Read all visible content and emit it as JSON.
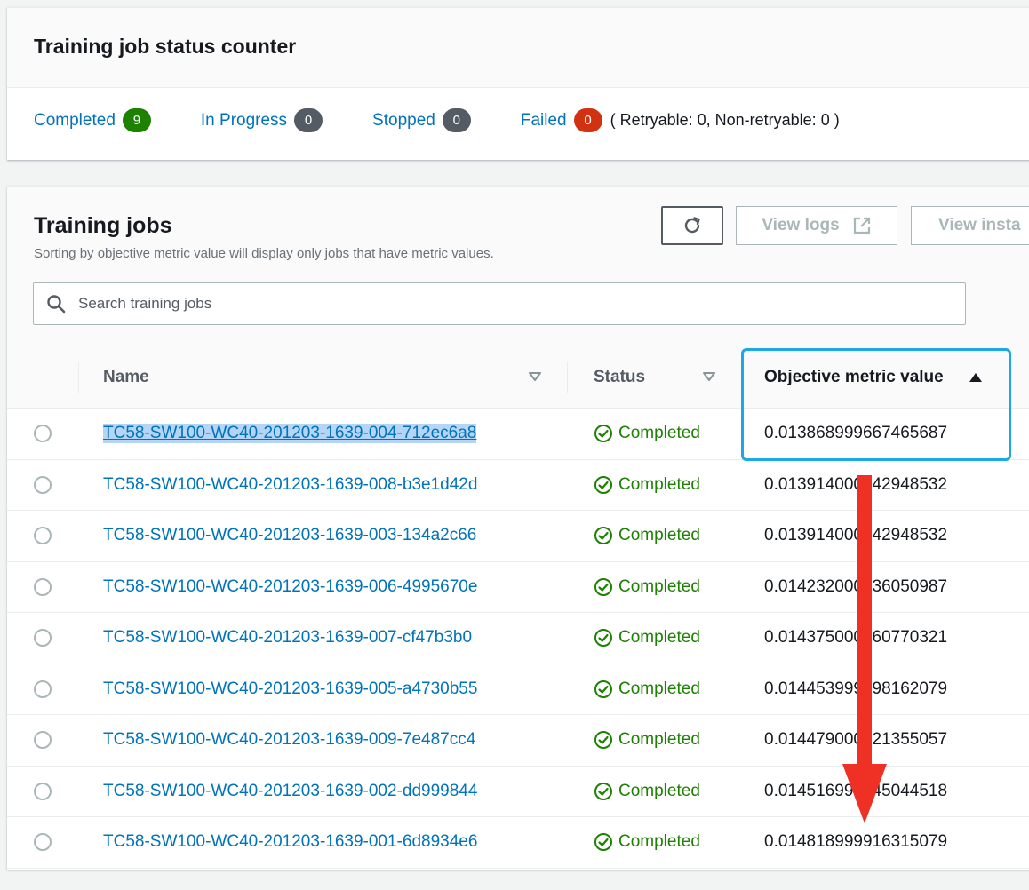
{
  "status_counter": {
    "title": "Training job status counter",
    "items": [
      {
        "label": "Completed",
        "count": "9",
        "color": "#1d8102"
      },
      {
        "label": "In Progress",
        "count": "0",
        "color": "#545b64"
      },
      {
        "label": "Stopped",
        "count": "0",
        "color": "#545b64"
      },
      {
        "label": "Failed",
        "count": "0",
        "color": "#d13212"
      }
    ],
    "failed_detail": "( Retryable: 0, Non-retryable: 0 )"
  },
  "jobs": {
    "title": "Training jobs",
    "subtitle": "Sorting by objective metric value will display only jobs that have metric values.",
    "view_logs_label": "View logs",
    "view_instance_label": "View insta",
    "search_placeholder": "Search training jobs",
    "columns": {
      "name": "Name",
      "status": "Status",
      "metric": "Objective metric value"
    },
    "rows": [
      {
        "name": "TC58-SW100-WC40-201203-1639-004-712ec6a8",
        "status": "Completed",
        "metric": "0.013868999667465687"
      },
      {
        "name": "TC58-SW100-WC40-201203-1639-008-b3e1d42d",
        "status": "Completed",
        "metric": "0.013914000242948532"
      },
      {
        "name": "TC58-SW100-WC40-201203-1639-003-134a2c66",
        "status": "Completed",
        "metric": "0.013914000242948532"
      },
      {
        "name": "TC58-SW100-WC40-201203-1639-006-4995670e",
        "status": "Completed",
        "metric": "0.014232000336050987"
      },
      {
        "name": "TC58-SW100-WC40-201203-1639-007-cf47b3b0",
        "status": "Completed",
        "metric": "0.014375000260770321"
      },
      {
        "name": "TC58-SW100-WC40-201203-1639-005-a4730b55",
        "status": "Completed",
        "metric": "0.014453999698162079"
      },
      {
        "name": "TC58-SW100-WC40-201203-1639-009-7e487cc4",
        "status": "Completed",
        "metric": "0.014479000121355057"
      },
      {
        "name": "TC58-SW100-WC40-201203-1639-002-dd999844",
        "status": "Completed",
        "metric": "0.014516999945044518"
      },
      {
        "name": "TC58-SW100-WC40-201203-1639-001-6d8934e6",
        "status": "Completed",
        "metric": "0.014818999916315079"
      }
    ]
  },
  "colors": {
    "link": "#0073bb",
    "success": "#1d8102",
    "highlight": "#1ea7e6",
    "annotation_arrow": "#ee3124"
  }
}
